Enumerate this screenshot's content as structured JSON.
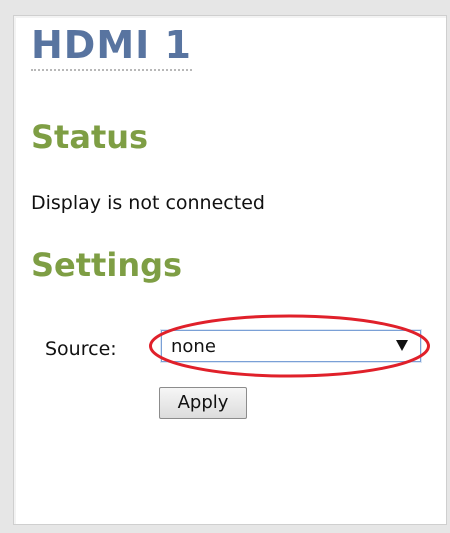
{
  "page": {
    "title": "HDMI 1"
  },
  "status": {
    "heading": "Status",
    "text": "Display is not connected"
  },
  "settings": {
    "heading": "Settings",
    "source_label": "Source:",
    "source_value": "none",
    "apply_label": "Apply"
  },
  "colors": {
    "title": "#5874a0",
    "section_heading": "#7e9e44",
    "highlight": "#e0202a"
  },
  "icons": {
    "dropdown": "chevron-down-icon"
  }
}
